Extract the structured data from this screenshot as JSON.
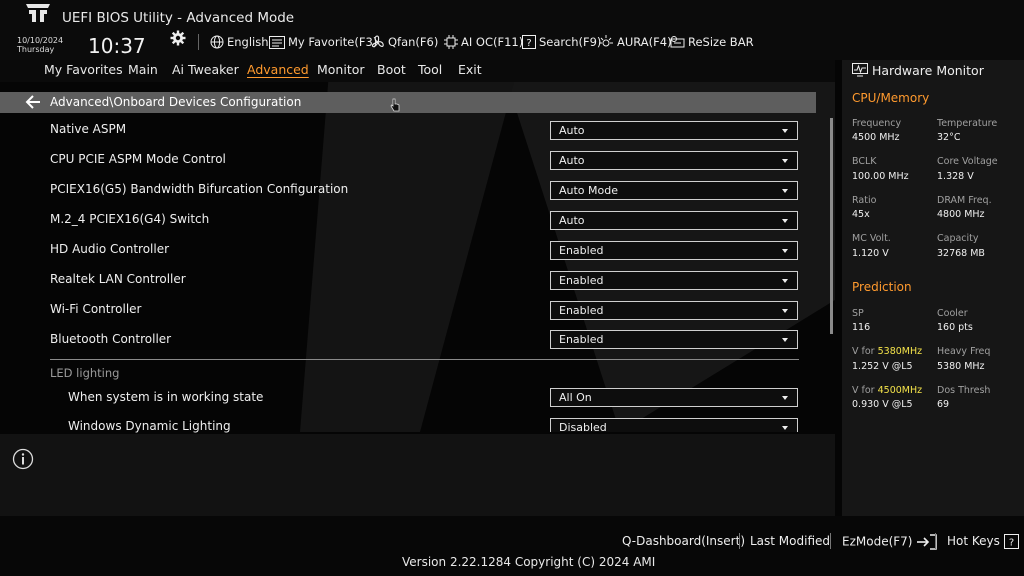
{
  "app": {
    "title": "UEFI BIOS Utility - Advanced Mode"
  },
  "clock": {
    "date": "10/10/2024",
    "day": "Thursday",
    "time": "10:37"
  },
  "toolbar": {
    "language": "English",
    "favorite": "My Favorite(F3)",
    "qfan": "Qfan(F6)",
    "aioc": "AI OC(F11)",
    "search": "Search(F9)",
    "aura": "AURA(F4)",
    "resize_bar": "ReSize BAR"
  },
  "tabs": [
    {
      "label": "My Favorites"
    },
    {
      "label": "Main"
    },
    {
      "label": "Ai Tweaker"
    },
    {
      "label": "Advanced",
      "active": true
    },
    {
      "label": "Monitor"
    },
    {
      "label": "Boot"
    },
    {
      "label": "Tool"
    },
    {
      "label": "Exit"
    }
  ],
  "breadcrumb": "Advanced\\Onboard Devices Configuration",
  "settings": [
    {
      "label": "Native ASPM",
      "value": "Auto"
    },
    {
      "label": "CPU PCIE ASPM Mode Control",
      "value": "Auto"
    },
    {
      "label": "PCIEX16(G5) Bandwidth Bifurcation Configuration",
      "value": "Auto Mode"
    },
    {
      "label": "M.2_4 PCIEX16(G4) Switch",
      "value": "Auto"
    },
    {
      "label": "HD Audio Controller",
      "value": "Enabled"
    },
    {
      "label": "Realtek LAN Controller",
      "value": "Enabled"
    },
    {
      "label": "Wi-Fi Controller",
      "value": "Enabled"
    },
    {
      "label": "Bluetooth Controller",
      "value": "Enabled"
    }
  ],
  "led_section": {
    "title": "LED lighting",
    "items": [
      {
        "label": "When system is in working state",
        "value": "All On"
      },
      {
        "label": "Windows Dynamic Lighting",
        "value": "Disabled"
      }
    ]
  },
  "hardware_monitor": {
    "title": "Hardware Monitor",
    "cpu_memory": {
      "title": "CPU/Memory",
      "items": [
        {
          "label": "Frequency",
          "value": "4500 MHz"
        },
        {
          "label": "Temperature",
          "value": "32°C"
        },
        {
          "label": "BCLK",
          "value": "100.00 MHz"
        },
        {
          "label": "Core Voltage",
          "value": "1.328 V"
        },
        {
          "label": "Ratio",
          "value": "45x"
        },
        {
          "label": "DRAM Freq.",
          "value": "4800 MHz"
        },
        {
          "label": "MC Volt.",
          "value": "1.120 V"
        },
        {
          "label": "Capacity",
          "value": "32768 MB"
        }
      ]
    },
    "prediction": {
      "title": "Prediction",
      "sp_label": "SP",
      "sp_value": "116",
      "cooler_label": "Cooler",
      "cooler_value": "160 pts",
      "v1_prefix": "V for ",
      "v1_freq": "5380MHz",
      "v1_value": "1.252 V @L5",
      "heavy_label": "Heavy Freq",
      "heavy_value": "5380 MHz",
      "v2_prefix": "V for ",
      "v2_freq": "4500MHz",
      "v2_value": "0.930 V @L5",
      "dos_label": "Dos Thresh",
      "dos_value": "69"
    }
  },
  "footer": {
    "qdashboard": "Q-Dashboard(Insert)",
    "last_modified": "Last Modified",
    "ezmode": "EzMode(F7)",
    "hotkeys": "Hot Keys",
    "version": "Version 2.22.1284 Copyright (C) 2024 AMI"
  },
  "colors": {
    "accent": "#ff9a2e",
    "highlight": "#f4e34a",
    "breadcrumb_bar": "#5e5e5e"
  }
}
